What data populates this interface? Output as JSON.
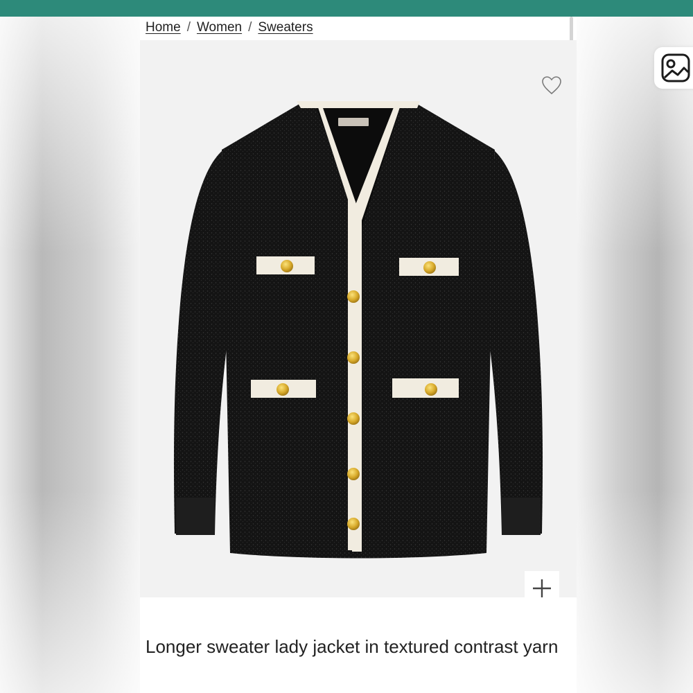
{
  "colors": {
    "top_bar": "#2d8a7a",
    "cardigan_body": "#141414",
    "trim": "#f1ece0",
    "buttons": "#d7a92a"
  },
  "breadcrumb": {
    "items": [
      "Home",
      "Women",
      "Sweaters"
    ],
    "separator": "/"
  },
  "product": {
    "title": "Longer sweater lady jacket in textured contrast yarn",
    "image_description_icon": "cardigan-image"
  },
  "icons": {
    "favorite": "heart-outline-icon",
    "add": "plus-icon",
    "image_search": "image-search-icon"
  }
}
